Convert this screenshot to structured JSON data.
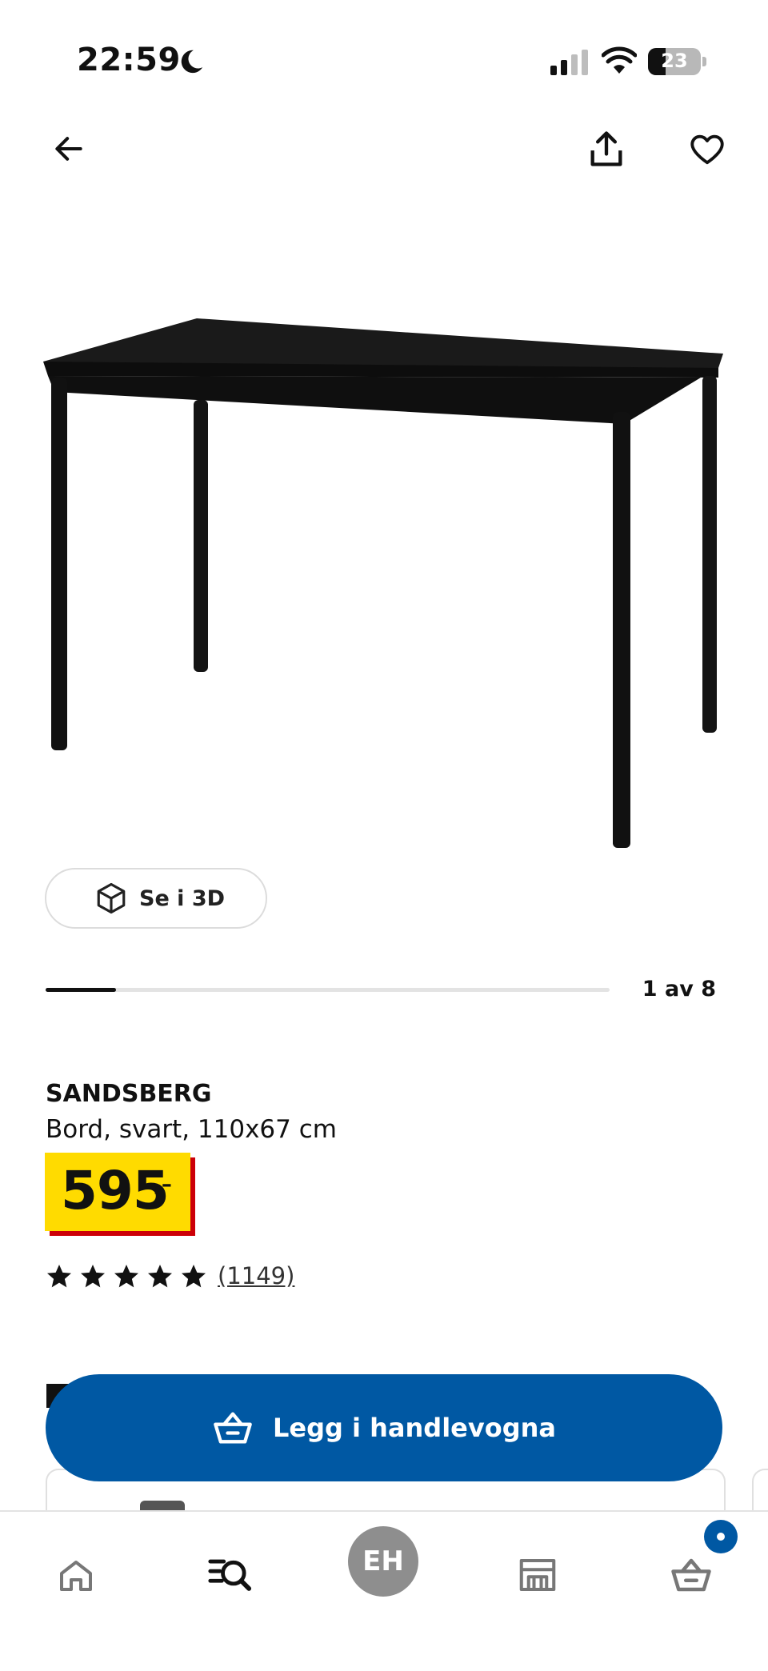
{
  "status_bar": {
    "time": "22:59",
    "battery": "23"
  },
  "header": {
    "back": "back",
    "share": "share",
    "favorite": "favorite"
  },
  "gallery": {
    "view_3d_label": "Se i 3D",
    "current": 1,
    "total": 8,
    "counter": "1 av 8"
  },
  "product": {
    "brand": "SANDSBERG",
    "description": "Bord, svart, 110x67 cm",
    "price": "595",
    "price_suffix": ",–",
    "rating": 5,
    "review_count": "(1149)"
  },
  "cta": {
    "label": "Legg i handlevogna"
  },
  "tabbar": {
    "items": [
      "home-icon",
      "search-icon",
      "profile",
      "store-icon",
      "cart-icon"
    ],
    "avatar_initials": "EH"
  },
  "colors": {
    "primary": "#0058a3",
    "price_yellow": "#ffdb00",
    "price_red": "#cc0008"
  }
}
